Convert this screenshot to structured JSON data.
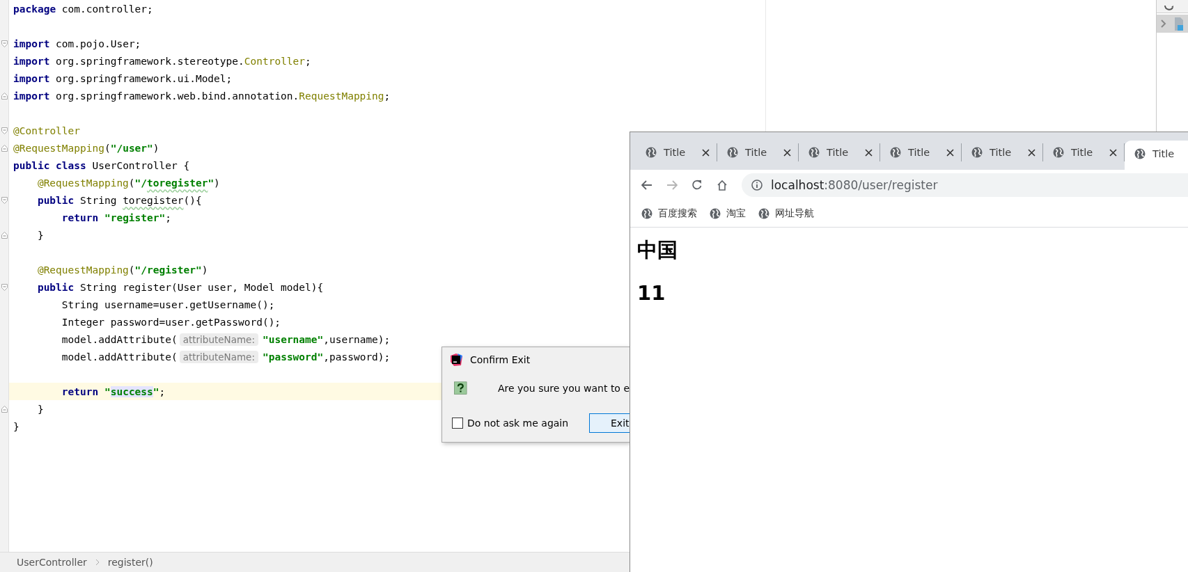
{
  "editor": {
    "lines": [
      {
        "kind": "plain",
        "current": false,
        "tokens": [
          {
            "kind": "kw",
            "text": "package"
          },
          {
            "kind": "txt",
            "text": " com.controller;"
          }
        ]
      },
      {
        "kind": "blank",
        "current": false
      },
      {
        "kind": "foldstart",
        "current": false,
        "tokens": [
          {
            "kind": "kw",
            "text": "import"
          },
          {
            "kind": "txt",
            "text": " com.pojo.User;"
          }
        ]
      },
      {
        "kind": "plain",
        "current": false,
        "tokens": [
          {
            "kind": "kw",
            "text": "import"
          },
          {
            "kind": "txt",
            "text": " org.springframework.stereotype."
          },
          {
            "kind": "cls",
            "text": "Controller"
          },
          {
            "kind": "txt",
            "text": ";"
          }
        ]
      },
      {
        "kind": "plain",
        "current": false,
        "tokens": [
          {
            "kind": "kw",
            "text": "import"
          },
          {
            "kind": "txt",
            "text": " org.springframework.ui.Model;"
          }
        ]
      },
      {
        "kind": "foldend",
        "current": false,
        "tokens": [
          {
            "kind": "kw",
            "text": "import"
          },
          {
            "kind": "txt",
            "text": " org.springframework.web.bind.annotation."
          },
          {
            "kind": "cls",
            "text": "RequestMapping"
          },
          {
            "kind": "txt",
            "text": ";"
          }
        ]
      },
      {
        "kind": "blank",
        "current": false
      },
      {
        "kind": "foldstart",
        "current": false,
        "tokens": [
          {
            "kind": "ann",
            "text": "@Controller"
          }
        ]
      },
      {
        "kind": "foldend",
        "current": false,
        "tokens": [
          {
            "kind": "ann",
            "text": "@RequestMapping"
          },
          {
            "kind": "txt",
            "text": "("
          },
          {
            "kind": "str",
            "text": "\"/user\""
          },
          {
            "kind": "txt",
            "text": ")"
          }
        ]
      },
      {
        "kind": "plain",
        "current": false,
        "tokens": [
          {
            "kind": "kw",
            "text": "public class"
          },
          {
            "kind": "txt",
            "text": " UserController {"
          }
        ]
      },
      {
        "kind": "plain",
        "current": false,
        "tokens": [
          {
            "kind": "ann",
            "text": "    @RequestMapping"
          },
          {
            "kind": "txt",
            "text": "("
          },
          {
            "kind": "str",
            "text": "\"/"
          },
          {
            "kind": "strtypo",
            "text": "toregister"
          },
          {
            "kind": "str",
            "text": "\""
          },
          {
            "kind": "txt",
            "text": ")"
          }
        ]
      },
      {
        "kind": "foldstart",
        "current": false,
        "tokens": [
          {
            "kind": "kw",
            "text": "    public"
          },
          {
            "kind": "txt",
            "text": " String "
          },
          {
            "kind": "txttypo",
            "text": "toregister"
          },
          {
            "kind": "txt",
            "text": "(){"
          }
        ]
      },
      {
        "kind": "plain",
        "current": false,
        "tokens": [
          {
            "kind": "kw",
            "text": "        return"
          },
          {
            "kind": "str",
            "text": " \"register\""
          },
          {
            "kind": "txt",
            "text": ";"
          }
        ]
      },
      {
        "kind": "foldend",
        "current": false,
        "tokens": [
          {
            "kind": "txt",
            "text": "    }"
          }
        ]
      },
      {
        "kind": "blank",
        "current": false
      },
      {
        "kind": "plain",
        "current": false,
        "tokens": [
          {
            "kind": "ann",
            "text": "    @RequestMapping"
          },
          {
            "kind": "txt",
            "text": "("
          },
          {
            "kind": "str",
            "text": "\"/register\""
          },
          {
            "kind": "txt",
            "text": ")"
          }
        ]
      },
      {
        "kind": "foldstart",
        "current": false,
        "tokens": [
          {
            "kind": "kw",
            "text": "    public"
          },
          {
            "kind": "txt",
            "text": " String register(User user, Model model){"
          }
        ]
      },
      {
        "kind": "plain",
        "current": false,
        "tokens": [
          {
            "kind": "txt",
            "text": "        String username=user.getUsername();"
          }
        ]
      },
      {
        "kind": "plain",
        "current": false,
        "tokens": [
          {
            "kind": "txt",
            "text": "        Integer password=user.getPassword();"
          }
        ]
      },
      {
        "kind": "plain",
        "current": false,
        "tokens": [
          {
            "kind": "txt",
            "text": "        model.addAttribute("
          },
          {
            "kind": "hint",
            "text": "attributeName:"
          },
          {
            "kind": "str",
            "text": "\"username\""
          },
          {
            "kind": "txt",
            "text": ",username);"
          }
        ]
      },
      {
        "kind": "plain",
        "current": false,
        "tokens": [
          {
            "kind": "txt",
            "text": "        model.addAttribute("
          },
          {
            "kind": "hint",
            "text": "attributeName:"
          },
          {
            "kind": "str",
            "text": "\"password\""
          },
          {
            "kind": "txt",
            "text": ",password);"
          }
        ]
      },
      {
        "kind": "blank",
        "current": false
      },
      {
        "kind": "plain",
        "current": true,
        "tokens": [
          {
            "kind": "kw",
            "text": "        return"
          },
          {
            "kind": "str",
            "text": " \""
          },
          {
            "kind": "strmark",
            "text": "success"
          },
          {
            "kind": "str",
            "text": "\""
          },
          {
            "kind": "txt",
            "text": ";"
          }
        ]
      },
      {
        "kind": "foldend",
        "current": false,
        "tokens": [
          {
            "kind": "txt",
            "text": "    }"
          }
        ]
      },
      {
        "kind": "plain",
        "current": false,
        "tokens": [
          {
            "kind": "txt",
            "text": "}"
          }
        ]
      }
    ]
  },
  "breadcrumb": [
    "UserController",
    "register()"
  ],
  "dialog": {
    "title": "Confirm Exit",
    "message": "Are you sure you want to e",
    "checkbox": {
      "label": "Do not ask me again",
      "checked": false
    },
    "button": "Exit"
  },
  "browser": {
    "tabs": [
      {
        "title": "Title",
        "selected": false
      },
      {
        "title": "Title",
        "selected": false
      },
      {
        "title": "Title",
        "selected": false
      },
      {
        "title": "Title",
        "selected": false
      },
      {
        "title": "Title",
        "selected": false
      },
      {
        "title": "Title",
        "selected": false
      },
      {
        "title": "Title",
        "selected": true
      }
    ],
    "address": {
      "host": "localhost",
      "path": ":8080/user/register"
    },
    "bookmarks": [
      "百度搜索",
      "淘宝",
      "网址导航"
    ],
    "headings": [
      "中国",
      "11"
    ]
  }
}
